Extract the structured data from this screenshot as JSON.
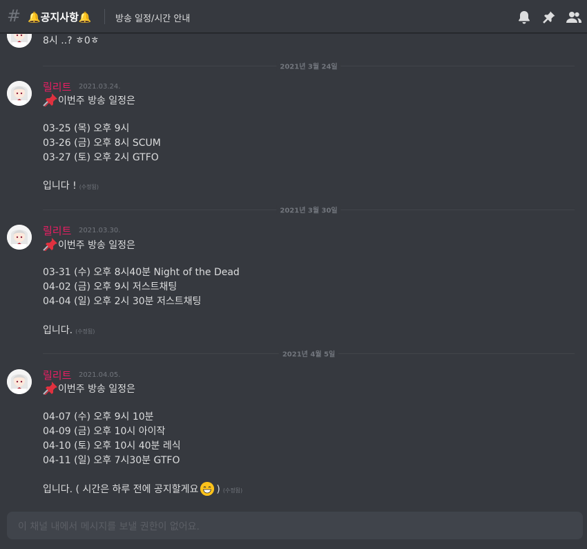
{
  "header": {
    "channel_title": "🔔공지사항🔔",
    "topic": "방송 일정/시간 안내"
  },
  "messages_top": {
    "partial_line": "8시 ..? ㅎ0ㅎ"
  },
  "dividers": [
    "2021년 3월 24일",
    "2021년 3월 30일",
    "2021년 4월 5일"
  ],
  "posts": [
    {
      "author": "릴리트",
      "time": "2021.03.24.",
      "intro": "이번주 방송 일정은",
      "schedule": [
        "03-25 (목) 오후 9시",
        "03-26 (금) 오후 8시 SCUM",
        "03-27 (토) 오후 2시 GTFO"
      ],
      "closing": "입니다 !",
      "edited": "(수정됨)"
    },
    {
      "author": "릴리트",
      "time": "2021.03.30.",
      "intro": "이번주 방송 일정은",
      "schedule": [
        "03-31 (수) 오후 8시40분 Night of the Dead",
        "04-02 (금) 오후 9시 저스트채팅",
        "04-04 (일) 오후 2시 30분 저스트채팅"
      ],
      "closing": "입니다.",
      "edited": "(수정됨)"
    },
    {
      "author": "릴리트",
      "time": "2021.04.05.",
      "intro": "이번주 방송 일정은",
      "schedule": [
        "04-07 (수) 오후 9시 10분",
        "04-09 (금) 오후 10시 아이작",
        "04-10 (토) 오후 10시 40분 레식",
        "04-11 (일) 오후 7시30분 GTFO"
      ],
      "closing_a": "입니다. ( 시간은 하루 전에 공지할게요",
      "closing_b": ")",
      "edited": "(수정됨)"
    }
  ],
  "composer": {
    "placeholder": "이 채널 내에서 메시지를 보낼 권한이 없어요."
  },
  "icons": [
    "bell-icon",
    "pin-icon",
    "members-icon",
    "pushpin-emoji",
    "grinning-emoji"
  ],
  "colors": {
    "background": "#36393f",
    "username": "#e91e63",
    "text": "#dcddde",
    "muted": "#72767d"
  }
}
